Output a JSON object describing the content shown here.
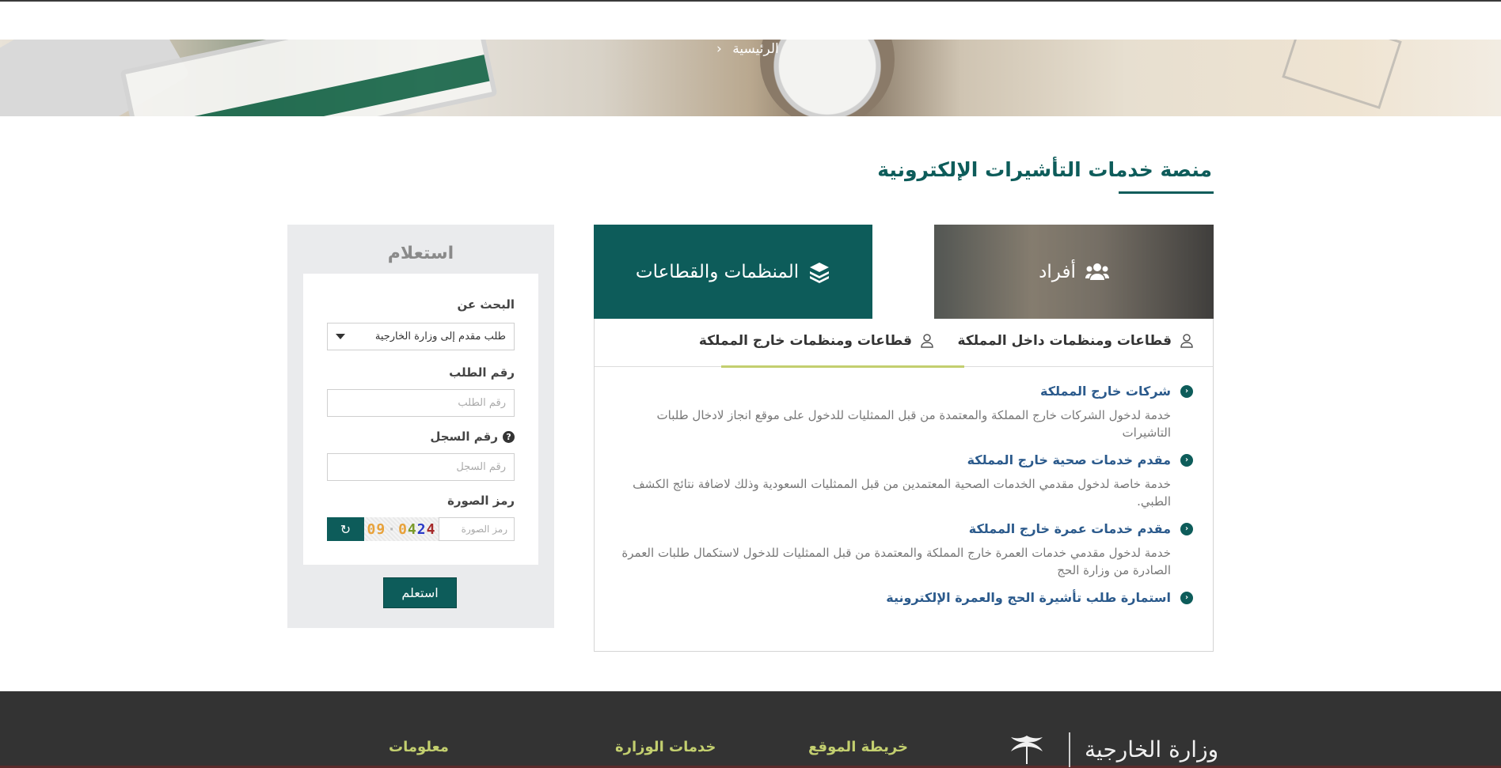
{
  "breadcrumb": {
    "home": "الرئيسية"
  },
  "page": {
    "title": "منصة خدمات التأشيرات الإلكترونية"
  },
  "categories": [
    {
      "label": "أفراد",
      "icon": "users-icon"
    },
    {
      "label": "المنظمات والقطاعات",
      "icon": "layers-icon"
    }
  ],
  "tabs": [
    {
      "label": "قطاعات ومنظمات داخل المملكة",
      "icon": "user-icon"
    },
    {
      "label": "قطاعات ومنظمات خارج المملكة",
      "icon": "user-icon",
      "active": true
    }
  ],
  "services": [
    {
      "title": "شركات خارج المملكة",
      "desc": "خدمة لدخول الشركات خارج المملكة والمعتمدة من قبل الممثليات للدخول على موقع انجاز لادخال طلبات التاشيرات"
    },
    {
      "title": "مقدم خدمات صحية خارج المملكة",
      "desc": "خدمة خاصة لدخول مقدمي الخدمات الصحية المعتمدين من قبل الممثليات السعودية وذلك لاضافة نتائج الكشف الطبي."
    },
    {
      "title": "مقدم خدمات عمرة خارج المملكة",
      "desc": "خدمة لدخول مقدمي خدمات العمرة خارج المملكة والمعتمدة من قبل الممثليات للدخول لاستكمال طلبات العمرة الصادرة من وزارة الحج"
    },
    {
      "title": "استمارة طلب تأشيرة الحج والعمرة الإلكترونية",
      "desc": ""
    }
  ],
  "inquiry": {
    "title": "استعلام",
    "search_label": "البحث عن",
    "search_value": "طلب مقدم إلى وزارة الخارجية",
    "request_label": "رقم الطلب",
    "request_placeholder": "رقم الطلب",
    "record_label": "رقم السجل",
    "record_placeholder": "رقم السجل",
    "captcha_label": "رمز الصورة",
    "captcha_placeholder": "رمز الصورة",
    "captcha_text": "09 0 4 2 4",
    "submit_label": "استعلم"
  },
  "footer": {
    "links": [
      "معلومات",
      "خدمات الوزارة",
      "خريطة الموقع"
    ],
    "logo_text": "وزارة الخارجية"
  },
  "colors": {
    "primary": "#0d5c5a",
    "accent": "#c3cf6f",
    "link": "#2b5a8c",
    "footer_bg": "#333333"
  }
}
